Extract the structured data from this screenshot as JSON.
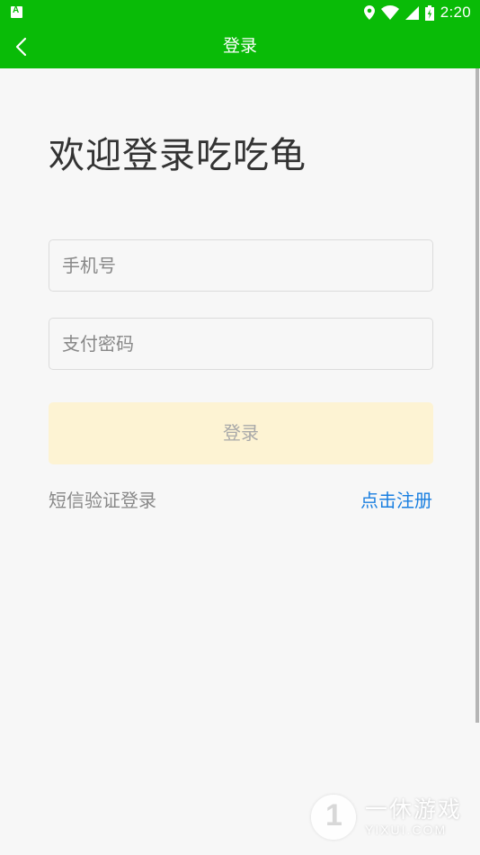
{
  "status_bar": {
    "time": "2:20",
    "icons": [
      "app-notification-icon",
      "location-icon",
      "wifi-icon",
      "signal-icon",
      "battery-icon"
    ]
  },
  "nav": {
    "title": "登录",
    "back_icon": "chevron-left-icon"
  },
  "welcome_text": "欢迎登录吃吃龟",
  "form": {
    "phone_placeholder": "手机号",
    "phone_value": "",
    "password_placeholder": "支付密码",
    "password_value": "",
    "login_label": "登录"
  },
  "links": {
    "sms_login": "短信验证登录",
    "register": "点击注册"
  },
  "watermark": {
    "title": "一休游戏",
    "subtitle": "YIXUI.COM"
  },
  "colors": {
    "brand_green": "#09bb07",
    "login_button_bg": "#fdf3d3",
    "link_blue": "#1a7fe0"
  }
}
